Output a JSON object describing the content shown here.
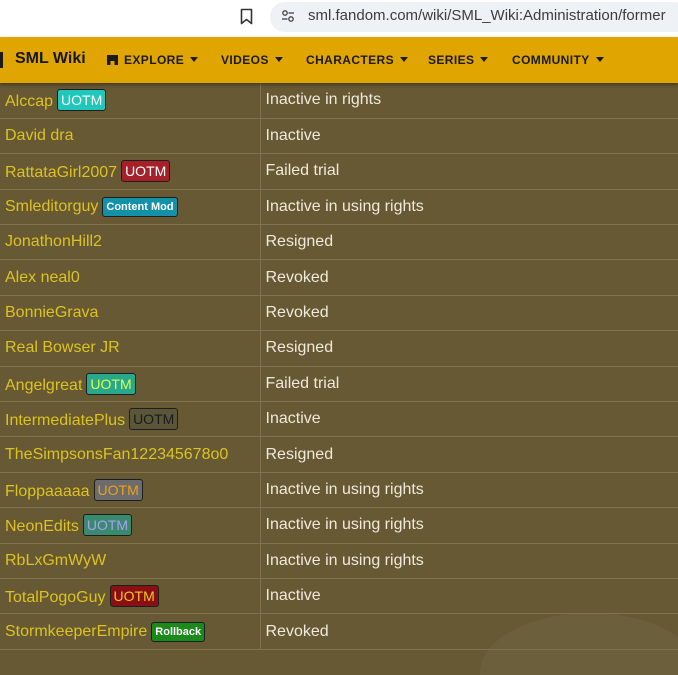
{
  "browser": {
    "url": "sml.fandom.com/wiki/SML_Wiki:Administration/former"
  },
  "nav": {
    "brand": "SML Wiki",
    "items": [
      {
        "label": "EXPLORE"
      },
      {
        "label": "VIDEOS"
      },
      {
        "label": "CHARACTERS"
      },
      {
        "label": "SERIES"
      },
      {
        "label": "COMMUNITY"
      }
    ]
  },
  "colors": {
    "nav_bg": "#e0a500",
    "content_bg": "#665933",
    "username": "#dcc321",
    "reason": "#efeadb"
  },
  "rows": [
    {
      "user": "Alccap",
      "badge": "UOTM",
      "badge_bg": "#1fc8bb",
      "badge_fg": "#ffffff",
      "reason": "Inactive in rights"
    },
    {
      "user": "David dra",
      "badge": "",
      "badge_bg": "",
      "badge_fg": "",
      "reason": "Inactive"
    },
    {
      "user": "RattataGirl2007",
      "badge": "UOTM",
      "badge_bg": "#a6202a",
      "badge_fg": "#ffffff",
      "reason": "Failed trial"
    },
    {
      "user": "Smleditorguy",
      "badge": "Content Mod",
      "badge_bg": "#1391a9",
      "badge_fg": "#ffffff",
      "reason": "Inactive in using rights"
    },
    {
      "user": "JonathonHill2",
      "badge": "",
      "badge_bg": "",
      "badge_fg": "",
      "reason": "Resigned"
    },
    {
      "user": "Alex neal0",
      "badge": "",
      "badge_bg": "",
      "badge_fg": "",
      "reason": "Revoked"
    },
    {
      "user": "BonnieGrava",
      "badge": "",
      "badge_bg": "",
      "badge_fg": "",
      "reason": "Revoked"
    },
    {
      "user": "Real Bowser JR",
      "badge": "",
      "badge_bg": "",
      "badge_fg": "",
      "reason": "Resigned"
    },
    {
      "user": "Angelgreat",
      "badge": "UOTM",
      "badge_bg": "#2aa88c",
      "badge_fg": "#d8ff4a",
      "reason": "Failed trial"
    },
    {
      "user": "IntermediatePlus",
      "badge": "UOTM",
      "badge_bg": "#5b5638",
      "badge_fg": "#1a1a1a",
      "reason": "Inactive"
    },
    {
      "user": "TheSimpsonsFan122345678o0",
      "badge": "",
      "badge_bg": "",
      "badge_fg": "",
      "reason": "Resigned"
    },
    {
      "user": "Floppaaaaa",
      "badge": "UOTM",
      "badge_bg": "#6c6c6c",
      "badge_fg": "#f0a018",
      "reason": "Inactive in using rights"
    },
    {
      "user": "NeonEdits",
      "badge": "UOTM",
      "badge_bg": "#3a8a70",
      "badge_fg": "#a9a0f2",
      "reason": "Inactive in using rights"
    },
    {
      "user": "RbLxGmWyW",
      "badge": "",
      "badge_bg": "",
      "badge_fg": "",
      "reason": "Inactive in using rights"
    },
    {
      "user": "TotalPogoGuy",
      "badge": "UOTM",
      "badge_bg": "#8a0f14",
      "badge_fg": "#f0c820",
      "reason": "Inactive"
    },
    {
      "user": "StormkeeperEmpire",
      "badge": "Rollback",
      "badge_bg": "#1b8a1b",
      "badge_fg": "#ffffff",
      "reason": "Revoked"
    }
  ]
}
